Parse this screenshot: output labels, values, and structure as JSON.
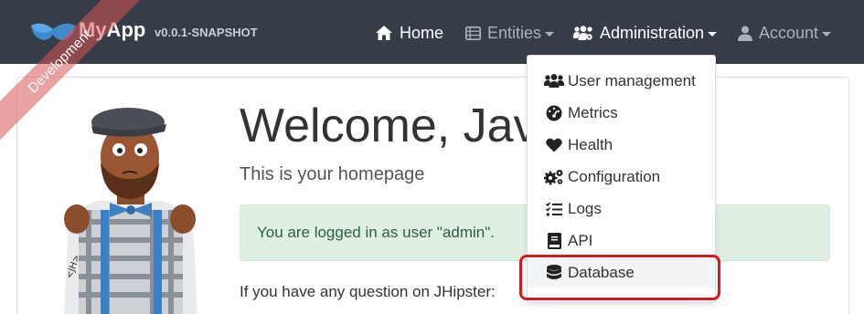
{
  "brand": {
    "name": "MyApp",
    "version": "v0.0.1-SNAPSHOT"
  },
  "ribbon": {
    "label": "Development"
  },
  "navbar": {
    "items": [
      {
        "label": "Home",
        "icon": "home-icon",
        "active": true,
        "dropdown": false
      },
      {
        "label": "Entities",
        "icon": "list-icon",
        "active": false,
        "dropdown": true
      },
      {
        "label": "Administration",
        "icon": "users-cog-icon",
        "active": true,
        "dropdown": true
      },
      {
        "label": "Account",
        "icon": "user-icon",
        "active": false,
        "dropdown": true
      }
    ]
  },
  "admin_menu": {
    "items": [
      {
        "label": "User management",
        "icon": "users-icon"
      },
      {
        "label": "Metrics",
        "icon": "tachometer-icon"
      },
      {
        "label": "Health",
        "icon": "heart-icon"
      },
      {
        "label": "Configuration",
        "icon": "cogs-icon"
      },
      {
        "label": "Logs",
        "icon": "tasks-icon"
      },
      {
        "label": "API",
        "icon": "book-icon"
      },
      {
        "label": "Database",
        "icon": "database-icon"
      }
    ],
    "highlighted": "Database"
  },
  "main": {
    "title": "Welcome, Java",
    "subtitle": "This is your homepage",
    "alert": "You are logged in as user \"admin\".",
    "question": "If you have any question on JHipster:"
  },
  "colors": {
    "navbar_bg": "#353d47",
    "alert_bg": "#dff0e3",
    "focus_ring": "#d6191d",
    "ribbon": "#d85656"
  }
}
